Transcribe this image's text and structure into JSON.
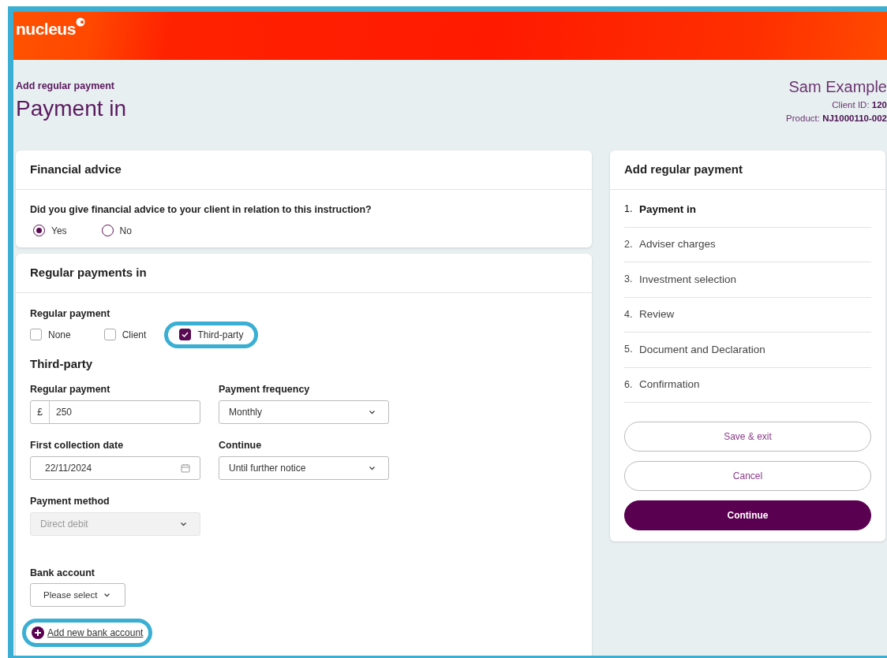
{
  "header": {
    "logo": "nucleus"
  },
  "page": {
    "breadcrumb": "Add regular payment",
    "title": "Payment in"
  },
  "client": {
    "name": "Sam Example",
    "client_id_label": "Client ID:",
    "client_id": "120",
    "product_label": "Product:",
    "product": "NJ1000110-002"
  },
  "financial_advice": {
    "title": "Financial advice",
    "question": "Did you give financial advice to your client in relation to this instruction?",
    "options": [
      {
        "label": "Yes",
        "selected": true
      },
      {
        "label": "No",
        "selected": false
      }
    ]
  },
  "regular_payments": {
    "title": "Regular payments in",
    "group_label": "Regular payment",
    "options": [
      {
        "label": "None",
        "checked": false,
        "highlighted": false
      },
      {
        "label": "Client",
        "checked": false,
        "highlighted": false
      },
      {
        "label": "Third-party",
        "checked": true,
        "highlighted": true
      }
    ],
    "section_title": "Third-party",
    "fields": [
      {
        "kind": "amount",
        "label": "Regular payment",
        "prefix": "£",
        "value": "250",
        "disabled": false
      },
      {
        "kind": "select",
        "label": "Payment frequency",
        "value": "Monthly",
        "disabled": false
      },
      {
        "kind": "date",
        "label": "First collection date",
        "value": "22/11/2024",
        "disabled": false
      },
      {
        "kind": "select",
        "label": "Continue",
        "value": "Until further notice",
        "disabled": false
      },
      {
        "kind": "select",
        "label": "Payment method",
        "value": "Direct debit",
        "disabled": true
      }
    ],
    "bank_account": {
      "label": "Bank account",
      "value": "Please select"
    },
    "add_link": {
      "label": "Add new bank account",
      "highlighted": true
    }
  },
  "steps_panel": {
    "title": "Add regular payment",
    "steps": [
      {
        "number": "1.",
        "label": "Payment in",
        "selected": true
      },
      {
        "number": "2.",
        "label": "Adviser charges",
        "selected": false
      },
      {
        "number": "3.",
        "label": "Investment selection",
        "selected": false
      },
      {
        "number": "4.",
        "label": "Review",
        "selected": false
      },
      {
        "number": "5.",
        "label": "Document and Declaration",
        "selected": false
      },
      {
        "number": "6.",
        "label": "Confirmation",
        "selected": false
      }
    ],
    "buttons": [
      {
        "kind": "outline",
        "label": "Save & exit"
      },
      {
        "kind": "outline",
        "label": "Cancel"
      },
      {
        "kind": "primary",
        "label": "Continue"
      }
    ]
  }
}
